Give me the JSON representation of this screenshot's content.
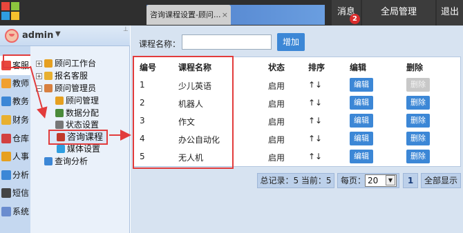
{
  "topbar": {
    "active_tab": "咨询课程设置-顾问...",
    "tab_close": "×",
    "message_label": "消息",
    "message_count": "2",
    "global_label": "全局管理",
    "exit_label": "退出"
  },
  "user": {
    "name": "admin",
    "caret": "▼"
  },
  "sidebar": {
    "items": [
      {
        "label": "客服",
        "icon": "headset-icon",
        "color": "#e8473c"
      },
      {
        "label": "教师",
        "icon": "book-icon",
        "color": "#f0a030"
      },
      {
        "label": "教务",
        "icon": "grid-icon",
        "color": "#3c87d6"
      },
      {
        "label": "财务",
        "icon": "money-icon",
        "color": "#e8b030"
      },
      {
        "label": "仓库",
        "icon": "home-icon",
        "color": "#d24040"
      },
      {
        "label": "人事",
        "icon": "person-icon",
        "color": "#e6a020"
      },
      {
        "label": "分析",
        "icon": "chart-icon",
        "color": "#3c87d6"
      },
      {
        "label": "短信",
        "icon": "phone-icon",
        "color": "#444444"
      },
      {
        "label": "系统",
        "icon": "settings-icon",
        "color": "#6a8ccf"
      }
    ]
  },
  "tree": {
    "nodes": [
      {
        "label": "顾问工作台",
        "expander": "+",
        "icon": "person-icon",
        "color": "#e6a020"
      },
      {
        "label": "报名客服",
        "expander": "+",
        "icon": "heart-icon",
        "color": "#e8b030"
      },
      {
        "label": "顾问管理员",
        "expander": "−",
        "icon": "group-icon",
        "color": "#d88040"
      },
      {
        "label": "顾问管理",
        "icon": "person-icon",
        "color": "#e6a020"
      },
      {
        "label": "数据分配",
        "icon": "database-icon",
        "color": "#4a8a3a"
      },
      {
        "label": "状态设置",
        "icon": "gear-icon",
        "color": "#777777"
      },
      {
        "label": "咨询课程",
        "icon": "book-icon",
        "color": "#c0392b"
      },
      {
        "label": "媒体设置",
        "icon": "monitor-icon",
        "color": "#2f9ee0"
      },
      {
        "label": "查询分析",
        "icon": "search-icon",
        "color": "#3c87d6"
      }
    ]
  },
  "search": {
    "label": "课程名称：",
    "value": "",
    "placeholder": "",
    "add_label": "增加"
  },
  "table": {
    "headers": [
      "编号",
      "课程名称",
      "状态",
      "排序",
      "编辑",
      "删除"
    ],
    "rows": [
      {
        "id": "1",
        "name": "少儿英语",
        "status": "启用",
        "order": "↑↓",
        "edit": "编辑",
        "delete": "删除",
        "delete_disabled": true
      },
      {
        "id": "2",
        "name": "机器人",
        "status": "启用",
        "order": "↑↓",
        "edit": "编辑",
        "delete": "删除",
        "delete_disabled": false
      },
      {
        "id": "3",
        "name": "作文",
        "status": "启用",
        "order": "↑↓",
        "edit": "编辑",
        "delete": "删除",
        "delete_disabled": false
      },
      {
        "id": "4",
        "name": "办公自动化",
        "status": "启用",
        "order": "↑↓",
        "edit": "编辑",
        "delete": "删除",
        "delete_disabled": false
      },
      {
        "id": "5",
        "name": "无人机",
        "status": "启用",
        "order": "↑↓",
        "edit": "编辑",
        "delete": "删除",
        "delete_disabled": false
      }
    ]
  },
  "pager": {
    "summary": "总记录：5 当前：5",
    "per_page_label": "每页：",
    "per_page_value": "20",
    "current_page": "1",
    "show_all": "全部显示"
  },
  "annotations": {
    "color": "#e23b3b"
  }
}
